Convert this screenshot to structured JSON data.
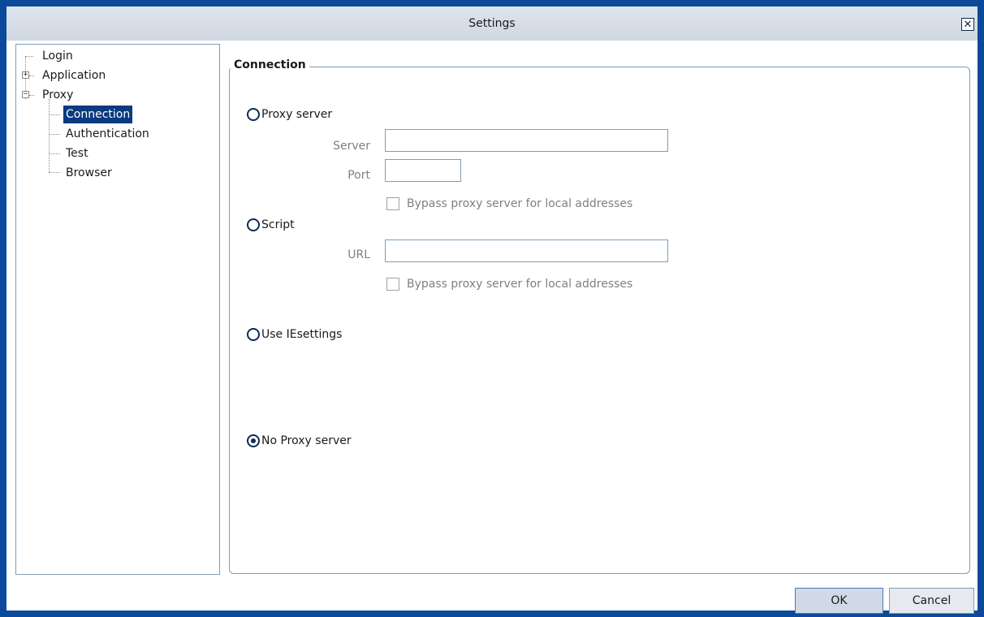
{
  "window": {
    "title": "Settings"
  },
  "tree": {
    "items": [
      {
        "label": "Login"
      },
      {
        "label": "Application"
      },
      {
        "label": "Proxy"
      },
      {
        "label": "Connection",
        "selected": true
      },
      {
        "label": "Authentication"
      },
      {
        "label": "Test"
      },
      {
        "label": "Browser"
      }
    ]
  },
  "connection": {
    "group_title": "Connection",
    "proxy_server": {
      "label": "Proxy server",
      "server_label": "Server",
      "server_value": "",
      "port_label": "Port",
      "port_value": "",
      "bypass_label": "Bypass proxy server for local addresses"
    },
    "script": {
      "label": "Script",
      "url_label": "URL",
      "url_value": "",
      "bypass_label": "Bypass proxy server for local addresses"
    },
    "ie_settings": {
      "label": "Use IEsettings"
    },
    "no_proxy": {
      "label": "No Proxy server"
    },
    "selected_option": "No Proxy server"
  },
  "buttons": {
    "ok": "OK",
    "cancel": "Cancel"
  },
  "colors": {
    "frame": "#0b4a9a",
    "selection": "#0a3a80",
    "border": "#7f9db9"
  }
}
